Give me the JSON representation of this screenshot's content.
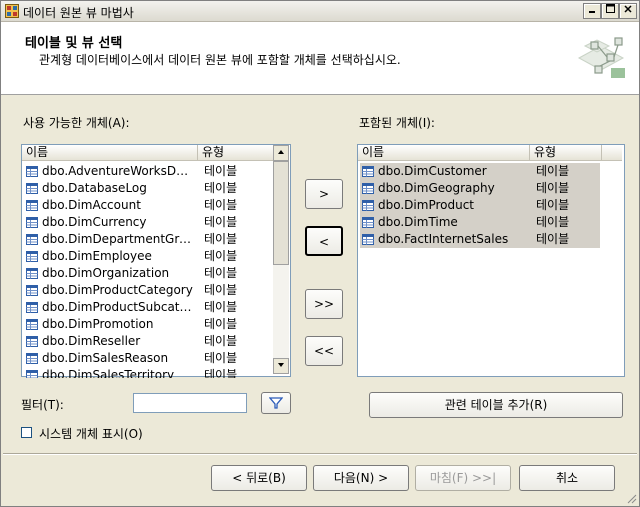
{
  "window": {
    "title": "데이터 원본 뷰 마법사"
  },
  "header": {
    "title": "테이블 및 뷰 선택",
    "subtitle": "관계형 데이터베이스에서 데이터 원본 뷰에 포함할 개체를 선택하십시오."
  },
  "available": {
    "label": "사용 가능한 개체(A):",
    "columns": [
      "이름",
      "유형"
    ],
    "rows": [
      {
        "name": "dbo.AdventureWorksDWB...",
        "type": "테이블"
      },
      {
        "name": "dbo.DatabaseLog",
        "type": "테이블"
      },
      {
        "name": "dbo.DimAccount",
        "type": "테이블"
      },
      {
        "name": "dbo.DimCurrency",
        "type": "테이블"
      },
      {
        "name": "dbo.DimDepartmentGroup",
        "type": "테이블"
      },
      {
        "name": "dbo.DimEmployee",
        "type": "테이블"
      },
      {
        "name": "dbo.DimOrganization",
        "type": "테이블"
      },
      {
        "name": "dbo.DimProductCategory",
        "type": "테이블"
      },
      {
        "name": "dbo.DimProductSubcate...",
        "type": "테이블"
      },
      {
        "name": "dbo.DimPromotion",
        "type": "테이블"
      },
      {
        "name": "dbo.DimReseller",
        "type": "테이블"
      },
      {
        "name": "dbo.DimSalesReason",
        "type": "테이블"
      },
      {
        "name": "dbo.DimSalesTerritory",
        "type": "테이블"
      }
    ]
  },
  "included": {
    "label": "포함된 개체(I):",
    "columns": [
      "이름",
      "유형"
    ],
    "rows": [
      {
        "name": "dbo.DimCustomer",
        "type": "테이블"
      },
      {
        "name": "dbo.DimGeography",
        "type": "테이블"
      },
      {
        "name": "dbo.DimProduct",
        "type": "테이블"
      },
      {
        "name": "dbo.DimTime",
        "type": "테이블"
      },
      {
        "name": "dbo.FactInternetSales",
        "type": "테이블"
      }
    ]
  },
  "transfer": {
    "add": ">",
    "remove": "<",
    "add_all": ">>",
    "remove_all": "<<"
  },
  "filter": {
    "label": "필터(T):",
    "value": ""
  },
  "show_system": {
    "label": "시스템 개체 표시(O)",
    "checked": false
  },
  "add_related": {
    "label": "관련 테이블 추가(R)"
  },
  "nav": {
    "back": "< 뒤로(B)",
    "next": "다음(N) >",
    "finish": "마침(F) >>|",
    "cancel": "취소"
  }
}
